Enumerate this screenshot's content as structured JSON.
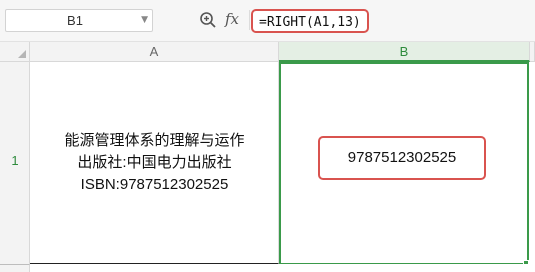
{
  "formula_bar": {
    "name_box": "B1",
    "zoom_icon": "zoom-in-icon",
    "fx_label": "fx",
    "formula": "=RIGHT(A1,13)"
  },
  "columns": [
    "A",
    "B"
  ],
  "rows": [
    "1"
  ],
  "cells": {
    "A1": {
      "lines": [
        "能源管理体系的理解与运作",
        "出版社:中国电力出版社",
        "ISBN:9787512302525"
      ]
    },
    "B1": {
      "value": "9787512302525"
    }
  },
  "colors": {
    "selection_green": "#3a9a4a",
    "highlight_red": "#d9534f"
  }
}
